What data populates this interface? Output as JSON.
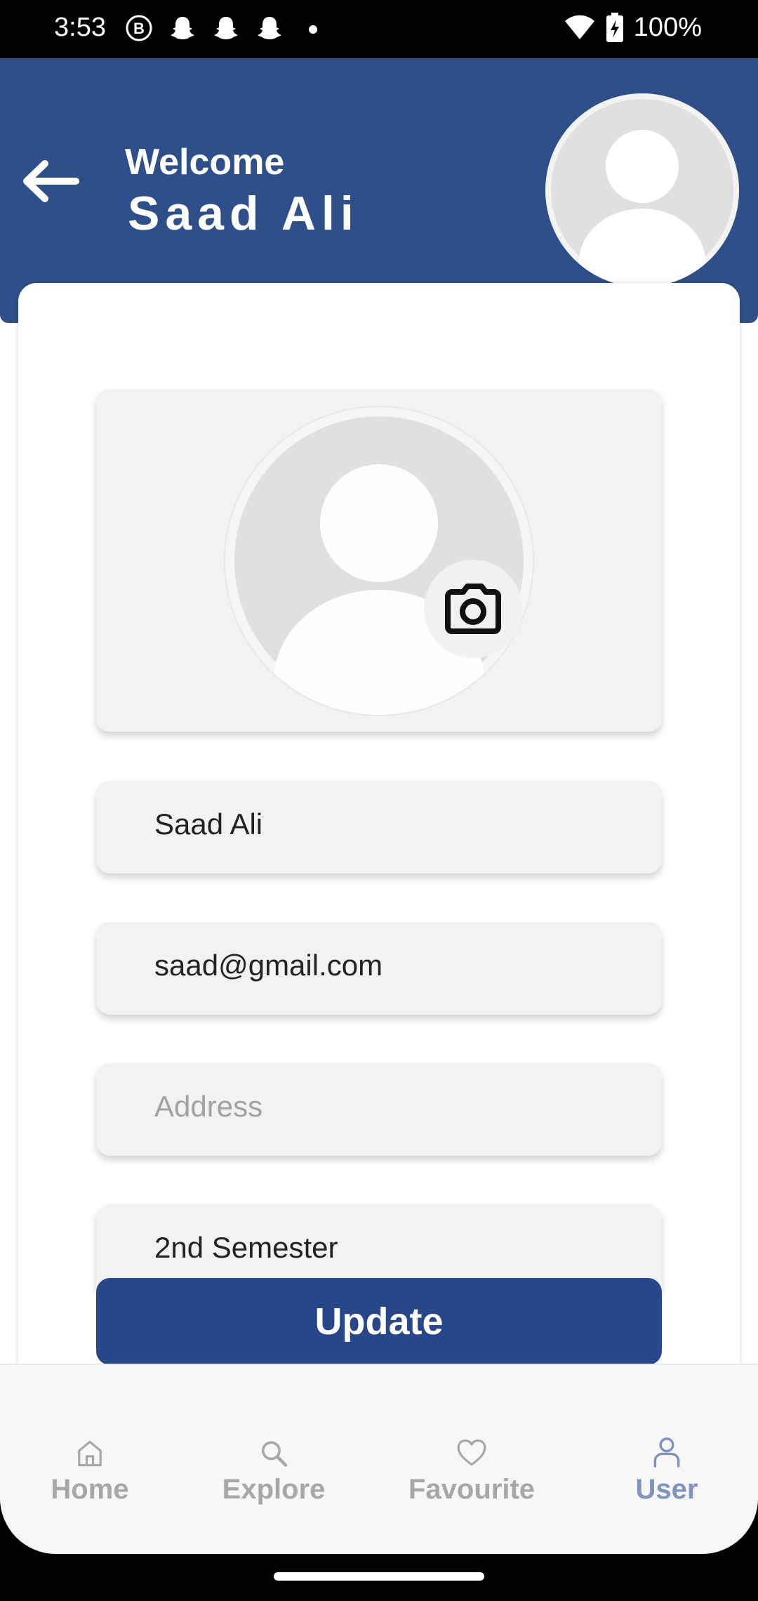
{
  "status_bar": {
    "time": "3:53",
    "battery_pct": "100%",
    "left_icons": [
      "b-badge-icon",
      "snapchat-icon",
      "snapchat-icon",
      "snapchat-icon",
      "dot-icon"
    ],
    "right_icons": [
      "wifi-icon",
      "battery-charging-icon"
    ]
  },
  "header": {
    "welcome": "Welcome",
    "name": "Saad Ali",
    "bg_color": "#2f4f8a"
  },
  "form": {
    "name_value": "Saad Ali",
    "email_value": "saad@gmail.com",
    "address_value": "",
    "address_placeholder": "Address",
    "semester_value": "2nd Semester",
    "update_label": "Update"
  },
  "nav": {
    "items": [
      {
        "label": "Home",
        "icon": "home-icon",
        "active": false
      },
      {
        "label": "Explore",
        "icon": "search-icon",
        "active": false
      },
      {
        "label": "Favourite",
        "icon": "heart-icon",
        "active": false
      },
      {
        "label": "User",
        "icon": "user-icon",
        "active": true
      }
    ]
  },
  "colors": {
    "primary": "#28478a",
    "nav_active": "#7f93be",
    "nav_inactive": "#a7a7a7"
  }
}
